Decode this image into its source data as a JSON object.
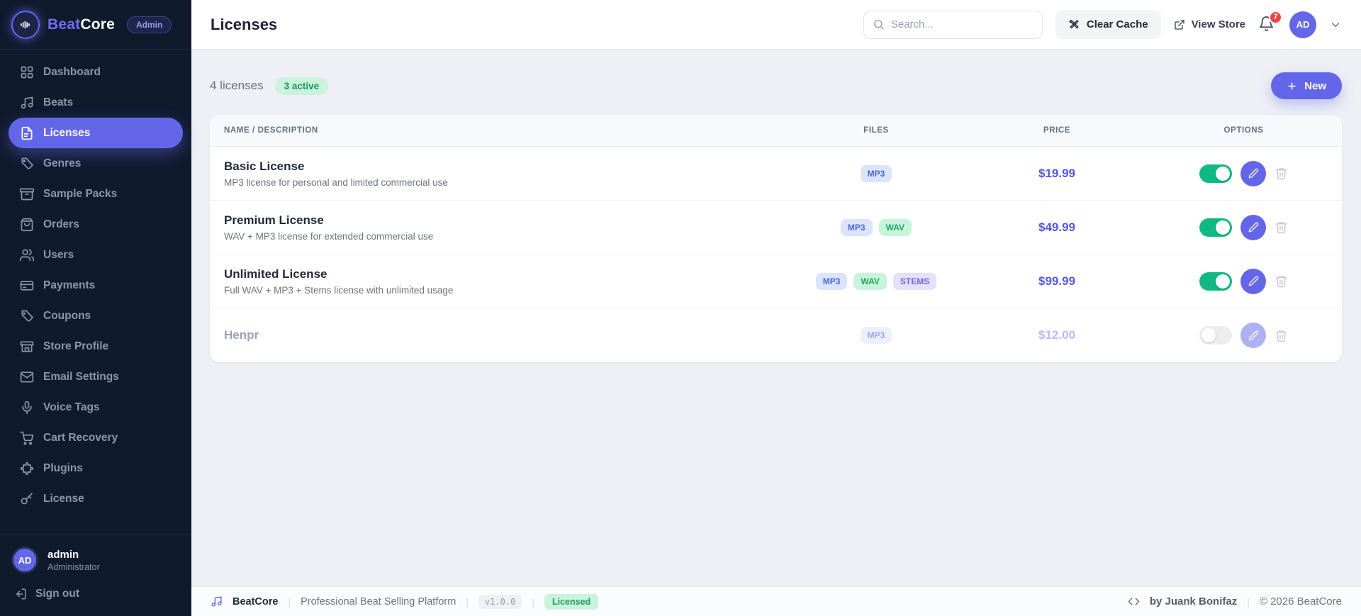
{
  "brand": {
    "name_part1": "Beat",
    "name_part2": "Core",
    "badge": "Admin"
  },
  "colors": {
    "accent": "#6466e9",
    "success": "#10b981",
    "danger": "#ef4444",
    "sidebar_bg": "#101a2d"
  },
  "sidebar": {
    "items": [
      {
        "label": "Dashboard"
      },
      {
        "label": "Beats"
      },
      {
        "label": "Licenses"
      },
      {
        "label": "Genres"
      },
      {
        "label": "Sample Packs"
      },
      {
        "label": "Orders"
      },
      {
        "label": "Users"
      },
      {
        "label": "Payments"
      },
      {
        "label": "Coupons"
      },
      {
        "label": "Store Profile"
      },
      {
        "label": "Email Settings"
      },
      {
        "label": "Voice Tags"
      },
      {
        "label": "Cart Recovery"
      },
      {
        "label": "Plugins"
      },
      {
        "label": "License"
      }
    ],
    "active_item": "Licenses",
    "user": {
      "initials": "AD",
      "name": "admin",
      "role": "Administrator"
    },
    "signout_label": "Sign out"
  },
  "header": {
    "title": "Licenses",
    "search_placeholder": "Search...",
    "clear_cache_label": "Clear Cache",
    "view_store_label": "View Store",
    "notification_count": "7",
    "avatar_initials": "AD"
  },
  "toolbar": {
    "count_label": "4 licenses",
    "active_badge": "3 active",
    "new_label": "New"
  },
  "table": {
    "columns": [
      "Name / Description",
      "Files",
      "Price",
      "Options"
    ],
    "rows": [
      {
        "name": "Basic License",
        "description": "MP3 license for personal and limited commercial use",
        "files": [
          "MP3"
        ],
        "price": "$19.99",
        "enabled": true
      },
      {
        "name": "Premium License",
        "description": "WAV + MP3 license for extended commercial use",
        "files": [
          "MP3",
          "WAV"
        ],
        "price": "$49.99",
        "enabled": true
      },
      {
        "name": "Unlimited License",
        "description": "Full WAV + MP3 + Stems license with unlimited usage",
        "files": [
          "MP3",
          "WAV",
          "STEMS"
        ],
        "price": "$99.99",
        "enabled": true
      },
      {
        "name": "Henpr",
        "description": "",
        "files": [
          "MP3"
        ],
        "price": "$12.00",
        "enabled": false
      }
    ]
  },
  "footer": {
    "brand": "BeatCore",
    "tagline": "Professional Beat Selling Platform",
    "version": "v1.0.0",
    "license_badge": "Licensed",
    "credit": "by Juank Bonifaz",
    "copyright": "© 2026 BeatCore"
  }
}
